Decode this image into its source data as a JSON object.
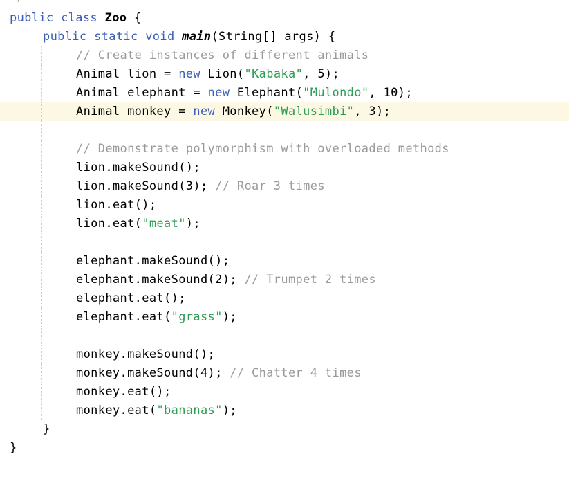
{
  "editor": {
    "top_fragment": "*/",
    "current_line_index": 5,
    "lines": [
      {
        "indent": 0,
        "tokens": [
          {
            "t": "public class ",
            "c": "kw"
          },
          {
            "t": "Zoo",
            "c": "cls"
          },
          {
            "t": " {",
            "c": "pl"
          }
        ]
      },
      {
        "indent": 1,
        "tokens": [
          {
            "t": "public static void ",
            "c": "kw"
          },
          {
            "t": "main",
            "c": "mth"
          },
          {
            "t": "(String[] args) {",
            "c": "pl"
          }
        ]
      },
      {
        "indent": 2,
        "tokens": [
          {
            "t": "// Create instances of different animals",
            "c": "com"
          }
        ]
      },
      {
        "indent": 2,
        "tokens": [
          {
            "t": "Animal lion = ",
            "c": "pl"
          },
          {
            "t": "new",
            "c": "kw"
          },
          {
            "t": " Lion(",
            "c": "pl"
          },
          {
            "t": "\"Kabaka\"",
            "c": "str"
          },
          {
            "t": ", 5);",
            "c": "pl"
          }
        ]
      },
      {
        "indent": 2,
        "tokens": [
          {
            "t": "Animal elephant = ",
            "c": "pl"
          },
          {
            "t": "new",
            "c": "kw"
          },
          {
            "t": " Elephant(",
            "c": "pl"
          },
          {
            "t": "\"Mulondo\"",
            "c": "str"
          },
          {
            "t": ", 10);",
            "c": "pl"
          }
        ]
      },
      {
        "indent": 2,
        "tokens": [
          {
            "t": "Animal monkey = ",
            "c": "pl"
          },
          {
            "t": "new",
            "c": "kw"
          },
          {
            "t": " Monkey(",
            "c": "pl"
          },
          {
            "t": "\"Walusimbi\"",
            "c": "str"
          },
          {
            "t": ", 3);",
            "c": "pl"
          }
        ]
      },
      {
        "indent": 2,
        "tokens": []
      },
      {
        "indent": 2,
        "tokens": [
          {
            "t": "// Demonstrate polymorphism with overloaded methods",
            "c": "com"
          }
        ]
      },
      {
        "indent": 2,
        "tokens": [
          {
            "t": "lion.makeSound();",
            "c": "pl"
          }
        ]
      },
      {
        "indent": 2,
        "tokens": [
          {
            "t": "lion.makeSound(3); ",
            "c": "pl"
          },
          {
            "t": "// Roar 3 times",
            "c": "com"
          }
        ]
      },
      {
        "indent": 2,
        "tokens": [
          {
            "t": "lion.eat();",
            "c": "pl"
          }
        ]
      },
      {
        "indent": 2,
        "tokens": [
          {
            "t": "lion.eat(",
            "c": "pl"
          },
          {
            "t": "\"meat\"",
            "c": "str"
          },
          {
            "t": ");",
            "c": "pl"
          }
        ]
      },
      {
        "indent": 2,
        "tokens": []
      },
      {
        "indent": 2,
        "tokens": [
          {
            "t": "elephant.makeSound();",
            "c": "pl"
          }
        ]
      },
      {
        "indent": 2,
        "tokens": [
          {
            "t": "elephant.makeSound(2); ",
            "c": "pl"
          },
          {
            "t": "// Trumpet 2 times",
            "c": "com"
          }
        ]
      },
      {
        "indent": 2,
        "tokens": [
          {
            "t": "elephant.eat();",
            "c": "pl"
          }
        ]
      },
      {
        "indent": 2,
        "tokens": [
          {
            "t": "elephant.eat(",
            "c": "pl"
          },
          {
            "t": "\"grass\"",
            "c": "str"
          },
          {
            "t": ");",
            "c": "pl"
          }
        ]
      },
      {
        "indent": 2,
        "tokens": []
      },
      {
        "indent": 2,
        "tokens": [
          {
            "t": "monkey.makeSound();",
            "c": "pl"
          }
        ]
      },
      {
        "indent": 2,
        "tokens": [
          {
            "t": "monkey.makeSound(4); ",
            "c": "pl"
          },
          {
            "t": "// Chatter 4 times",
            "c": "com"
          }
        ]
      },
      {
        "indent": 2,
        "tokens": [
          {
            "t": "monkey.eat();",
            "c": "pl"
          }
        ]
      },
      {
        "indent": 2,
        "tokens": [
          {
            "t": "monkey.eat(",
            "c": "pl"
          },
          {
            "t": "\"bananas\"",
            "c": "str"
          },
          {
            "t": ");",
            "c": "pl"
          }
        ]
      },
      {
        "indent": 1,
        "tokens": [
          {
            "t": "}",
            "c": "pl"
          }
        ]
      },
      {
        "indent": 0,
        "tokens": [
          {
            "t": "}",
            "c": "pl"
          }
        ]
      }
    ]
  },
  "colors": {
    "keyword": "#3c5eb5",
    "string": "#2e9e55",
    "comment": "#9a9a9a",
    "current_line": "#fcf8e3"
  }
}
